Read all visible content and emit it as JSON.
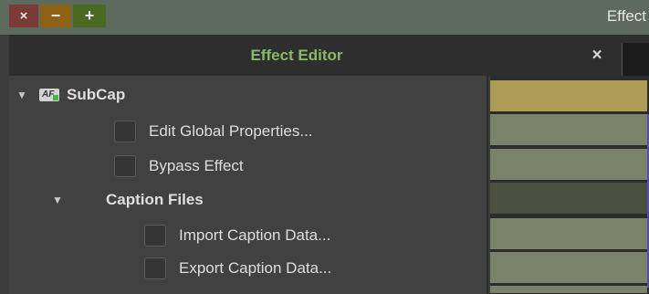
{
  "window": {
    "close_glyph": "×",
    "minimize_glyph": "−",
    "maximize_glyph": "+",
    "title": "Effect"
  },
  "editor": {
    "title": "Effect Editor",
    "close_glyph": "×"
  },
  "tree": {
    "expander_glyph": "▼",
    "effect": {
      "name": "SubCap",
      "icon": "effect-badge-icon",
      "icon_text": "AF"
    },
    "params": [
      {
        "label": "Edit Global Properties..."
      },
      {
        "label": "Bypass Effect"
      }
    ],
    "group": {
      "name": "Caption Files",
      "params": [
        {
          "label": "Import Caption Data..."
        },
        {
          "label": "Export Caption Data..."
        }
      ]
    }
  },
  "colors": {
    "title_green": "#88b86a",
    "keyframe_gold": "#ad9c56",
    "keyframe_olive": "#7a8269",
    "keyframe_dark": "#4c503f"
  }
}
